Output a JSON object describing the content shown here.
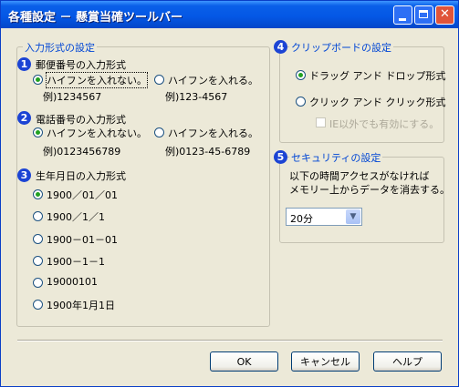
{
  "window": {
    "title": "各種設定 － 懸賞当確ツールバー",
    "controls": {
      "minimize": "minimize-icon",
      "maximize": "maximize-icon",
      "close": "close-icon"
    }
  },
  "input_format": {
    "legend": "入力形式の設定",
    "postal": {
      "number": "1",
      "title": "郵便番号の入力形式",
      "options": [
        "ハイフンを入れない。",
        "ハイフンを入れる。"
      ],
      "examples": [
        "例)1234567",
        "例)123-4567"
      ],
      "selected": 0
    },
    "phone": {
      "number": "2",
      "title": "電話番号の入力形式",
      "options": [
        "ハイフンを入れない。",
        "ハイフンを入れる。"
      ],
      "examples": [
        "例)0123456789",
        "例)0123-45-6789"
      ],
      "selected": 0
    },
    "birthday": {
      "number": "3",
      "title": "生年月日の入力形式",
      "options": [
        "1900／01／01",
        "1900／1／1",
        "1900－01－01",
        "1900－1－1",
        "19000101",
        "1900年1月1日"
      ],
      "selected": 0
    }
  },
  "clipboard": {
    "number": "4",
    "legend": "クリップボードの設定",
    "options": [
      "ドラッグ アンド ドロップ形式",
      "クリック アンド クリック形式"
    ],
    "selected": 0,
    "ie_only": {
      "label": "IE以外でも有効にする。",
      "checked": false,
      "enabled": false
    }
  },
  "security": {
    "number": "5",
    "legend": "セキュリティの設定",
    "description_line1": "以下の時間アクセスがなければ",
    "description_line2": "メモリー上からデータを消去する。",
    "timeout": "20分"
  },
  "buttons": {
    "ok": "OK",
    "cancel": "キャンセル",
    "help": "ヘルプ"
  },
  "colors": {
    "titlebar": "#0458e6",
    "legend_text": "#0046d5",
    "badge": "#1c44d4",
    "selected_dot": "#21a121"
  }
}
